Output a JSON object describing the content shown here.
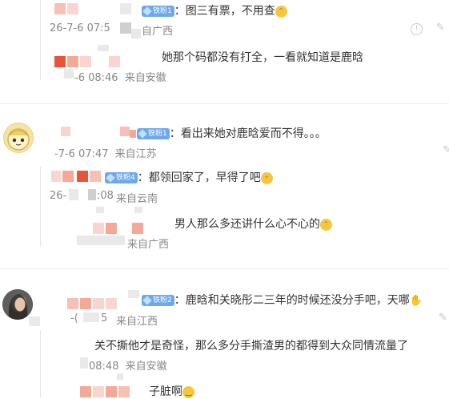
{
  "comments": [
    {
      "badge": "铁粉1",
      "text": "：图三有票，不用查",
      "time": "26-7-6 07:5",
      "loc": "自广西"
    },
    {
      "text": "她那个码都没有打全，一看就知道是鹿晗",
      "time": "-6 08:46",
      "loc": "来自安徽"
    },
    {
      "badge": "铁粉1",
      "text": "：看出来她对鹿晗爱而不得。。。",
      "time": "-7-6 07:47",
      "loc": "来自江苏"
    },
    {
      "badge": "铁粉4",
      "text": "：都领回家了，早得了吧",
      "time": "26-",
      "time2": ":08",
      "loc": "来自云南"
    },
    {
      "text": "男人那么多还讲什么心不心的",
      "loc": "来自广西"
    },
    {
      "badge": "铁粉2",
      "text": "：鹿晗和关晓彤二三年的时候还没分手吧，天哪",
      "time": "-(",
      "time2": "5",
      "loc": "来自江西"
    },
    {
      "text": "关不撕他才是奇怪，那么多分手撕渣男的都得到大众同情流量了",
      "time": "08:48",
      "loc": "来自安徽"
    },
    {
      "text": "子脏啊"
    }
  ],
  "icons": {
    "info": "info-circle-icon",
    "edit": "edit-icon",
    "emoji_smile": "smile-emoji-icon",
    "emoji_cat": "cat-emoji-icon",
    "emoji_grin": "grin-emoji-icon"
  }
}
